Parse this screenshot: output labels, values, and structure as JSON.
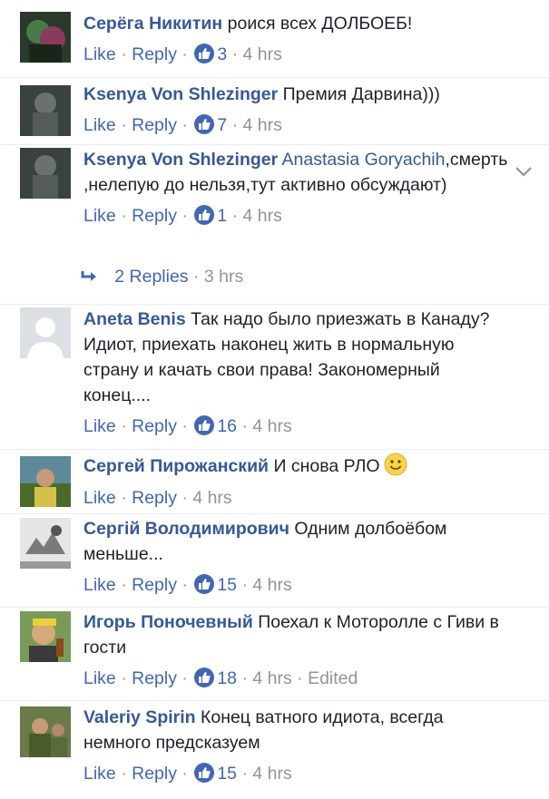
{
  "comments": [
    {
      "author": "Серёга Никитин",
      "text": "роися всех ДОЛБОЕБ!",
      "like": "Like",
      "reply": "Reply",
      "count": "3",
      "time": "4 hrs"
    },
    {
      "author": "Ksenya Von Shlezinger",
      "text": "Премия Дарвина)))",
      "like": "Like",
      "reply": "Reply",
      "count": "7",
      "time": "4 hrs"
    },
    {
      "author": "Ksenya Von Shlezinger",
      "mention": "Anastasia Goryachih",
      "text": ",смерть ,нелепую до нельзя,тут активно обсуждают)",
      "like": "Like",
      "reply": "Reply",
      "count": "1",
      "time": "4 hrs",
      "replies": {
        "label": "2 Replies",
        "time": "3 hrs"
      }
    },
    {
      "author": "Aneta Benis",
      "text": "Так надо было приезжать в Канаду? Идиот, приехать наконец жить в нормальную страну и качать свои права! Закономерный конец....",
      "like": "Like",
      "reply": "Reply",
      "count": "16",
      "time": "4 hrs"
    },
    {
      "author": "Сергей Пирожанский",
      "text": "И снова РЛО",
      "like": "Like",
      "reply": "Reply",
      "time": "4 hrs"
    },
    {
      "author": "Сергій Володимирович",
      "text": "Одним долбоёбом меньше...",
      "like": "Like",
      "reply": "Reply",
      "count": "15",
      "time": "4 hrs"
    },
    {
      "author": "Игорь Поночевный",
      "text": "Поехал к Моторолле с Гиви в гости",
      "like": "Like",
      "reply": "Reply",
      "count": "18",
      "time": "4 hrs",
      "edited": "Edited"
    },
    {
      "author": "Valeriy Spirin",
      "text": "Конец ватного идиота, всегда немного предсказуем",
      "like": "Like",
      "reply": "Reply",
      "count": "15",
      "time": "4 hrs"
    }
  ],
  "colors": {
    "link": "#4267b2",
    "author": "#365899",
    "meta": "#90949c"
  }
}
